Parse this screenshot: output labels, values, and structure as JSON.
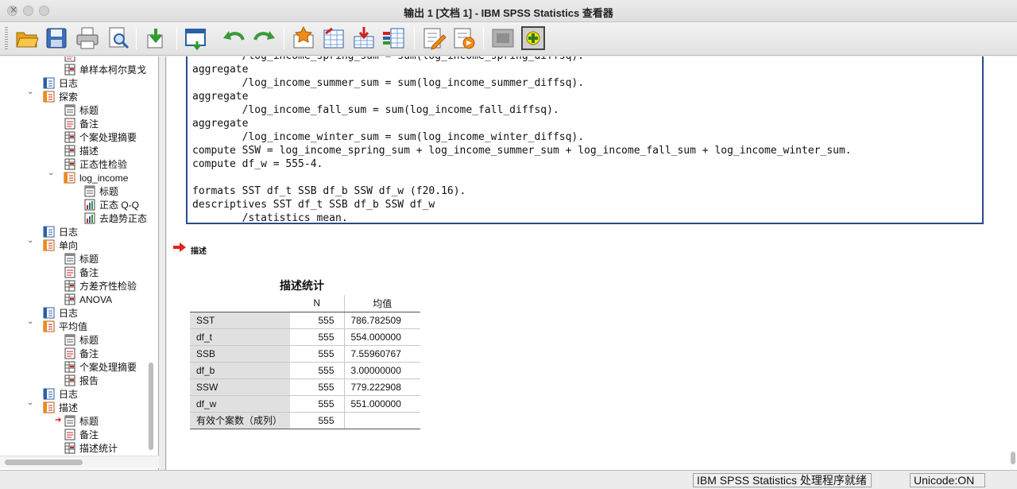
{
  "window": {
    "title": "输出 1 [文档 1] - IBM SPSS Statistics 查看器"
  },
  "toolbar": {
    "buttons": [
      {
        "name": "open-icon"
      },
      {
        "name": "save-icon"
      },
      {
        "name": "print-icon"
      },
      {
        "name": "print-preview-icon"
      },
      {
        "name": "export-icon"
      },
      {
        "name": "recall-dialog-icon"
      },
      {
        "name": "undo-icon"
      },
      {
        "name": "redo-icon"
      },
      {
        "name": "goto-data-icon"
      },
      {
        "name": "goto-case-icon"
      },
      {
        "name": "goto-variable-icon"
      },
      {
        "name": "variables-icon"
      },
      {
        "name": "create-title-icon"
      },
      {
        "name": "insert-output-icon"
      },
      {
        "name": "hide-icon"
      },
      {
        "name": "designate-window-icon"
      }
    ]
  },
  "outline": {
    "items": [
      {
        "label": "",
        "icon": "note",
        "indent": 3
      },
      {
        "label": "单样本柯尔莫戈",
        "icon": "table",
        "indent": 3
      },
      {
        "label": "日志",
        "icon": "log",
        "indent": 2
      },
      {
        "label": "探索",
        "icon": "folder",
        "indent": 2,
        "expanded": true
      },
      {
        "label": "标题",
        "icon": "title",
        "indent": 3
      },
      {
        "label": "备注",
        "icon": "note",
        "indent": 3
      },
      {
        "label": "个案处理摘要",
        "icon": "table",
        "indent": 3
      },
      {
        "label": "描述",
        "icon": "table",
        "indent": 3
      },
      {
        "label": "正态性检验",
        "icon": "table",
        "indent": 3
      },
      {
        "label": "log_income",
        "icon": "folder",
        "indent": 3,
        "expanded": true
      },
      {
        "label": "标题",
        "icon": "title",
        "indent": 4
      },
      {
        "label": "正态 Q-Q",
        "icon": "chart",
        "indent": 4
      },
      {
        "label": "去趋势正态",
        "icon": "chart",
        "indent": 4
      },
      {
        "label": "日志",
        "icon": "log",
        "indent": 2
      },
      {
        "label": "单向",
        "icon": "folder",
        "indent": 2,
        "expanded": true
      },
      {
        "label": "标题",
        "icon": "title",
        "indent": 3
      },
      {
        "label": "备注",
        "icon": "note",
        "indent": 3
      },
      {
        "label": "方差齐性检验",
        "icon": "table",
        "indent": 3
      },
      {
        "label": "ANOVA",
        "icon": "table",
        "indent": 3
      },
      {
        "label": "日志",
        "icon": "log",
        "indent": 2
      },
      {
        "label": "平均值",
        "icon": "folder",
        "indent": 2,
        "expanded": true
      },
      {
        "label": "标题",
        "icon": "title",
        "indent": 3
      },
      {
        "label": "备注",
        "icon": "note",
        "indent": 3
      },
      {
        "label": "个案处理摘要",
        "icon": "table",
        "indent": 3
      },
      {
        "label": "报告",
        "icon": "table",
        "indent": 3
      },
      {
        "label": "日志",
        "icon": "log",
        "indent": 2
      },
      {
        "label": "描述",
        "icon": "folder",
        "indent": 2,
        "expanded": true
      },
      {
        "label": "标题",
        "icon": "title",
        "indent": 3,
        "current": true
      },
      {
        "label": "备注",
        "icon": "note",
        "indent": 3
      },
      {
        "label": "描述统计",
        "icon": "table",
        "indent": 3
      }
    ]
  },
  "syntax": {
    "text": "aggregate\n        /log_income_summer_sum = sum(log_income_summer_diffsq).\naggregate\n        /log_income_fall_sum = sum(log_income_fall_diffsq).\naggregate\n        /log_income_winter_sum = sum(log_income_winter_diffsq).\ncompute SSW = log_income_spring_sum + log_income_summer_sum + log_income_fall_sum + log_income_winter_sum.\ncompute df_w = 555-4.\n\nformats SST df_t SSB df_b SSW df_w (f20.16).\ndescriptives SST df_t SSB df_b SSW df_w\n        /statistics mean."
  },
  "output": {
    "node_label": "描述",
    "table_title": "描述统计",
    "columns": [
      "N",
      "均值"
    ],
    "rows": [
      {
        "label": "SST",
        "n": "555",
        "mean": "786.782509"
      },
      {
        "label": "df_t",
        "n": "555",
        "mean": "554.000000"
      },
      {
        "label": "SSB",
        "n": "555",
        "mean": "7.55960767"
      },
      {
        "label": "df_b",
        "n": "555",
        "mean": "3.00000000"
      },
      {
        "label": "SSW",
        "n": "555",
        "mean": "779.222908"
      },
      {
        "label": "df_w",
        "n": "555",
        "mean": "551.000000"
      },
      {
        "label": "有效个案数（成列）",
        "n": "555",
        "mean": ""
      }
    ]
  },
  "status": {
    "processor": "IBM SPSS Statistics 处理程序就绪",
    "unicode": "Unicode:ON"
  }
}
